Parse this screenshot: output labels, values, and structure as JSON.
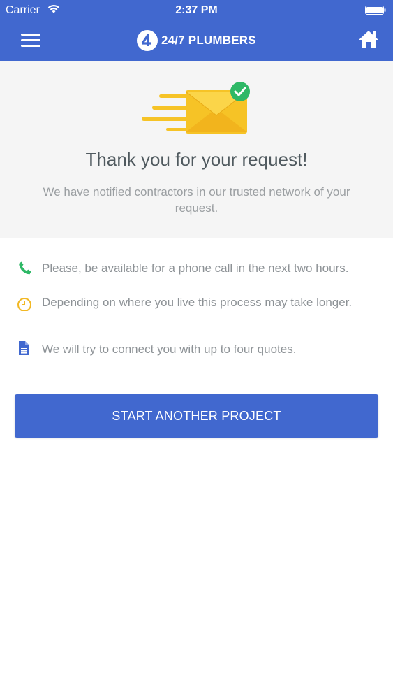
{
  "status_bar": {
    "carrier": "Carrier",
    "time": "2:37 PM"
  },
  "nav": {
    "brand": "24/7 PLUMBERS",
    "menu_icon": "hamburger-menu-icon",
    "home_icon": "home-icon"
  },
  "hero": {
    "illustration_icon": "envelope-sent-check-icon",
    "title": "Thank you for your request!",
    "subtitle": "We have notified contractors in our trusted network of your request."
  },
  "info_items": [
    {
      "icon": "phone-icon",
      "color": "#2eb866",
      "text": "Please, be available for a phone call in the next two hours."
    },
    {
      "icon": "clock-icon",
      "color": "#f2b824",
      "text": "Depending on where you live this process may take longer."
    },
    {
      "icon": "document-icon",
      "color": "#4168cf",
      "text": "We will try to connect you with up to four quotes."
    }
  ],
  "cta": {
    "label": "START ANOTHER PROJECT"
  },
  "colors": {
    "brand_blue": "#4168cf",
    "hero_background": "#f5f5f5",
    "envelope_yellow": "#f6c326",
    "check_green": "#2eb866"
  }
}
